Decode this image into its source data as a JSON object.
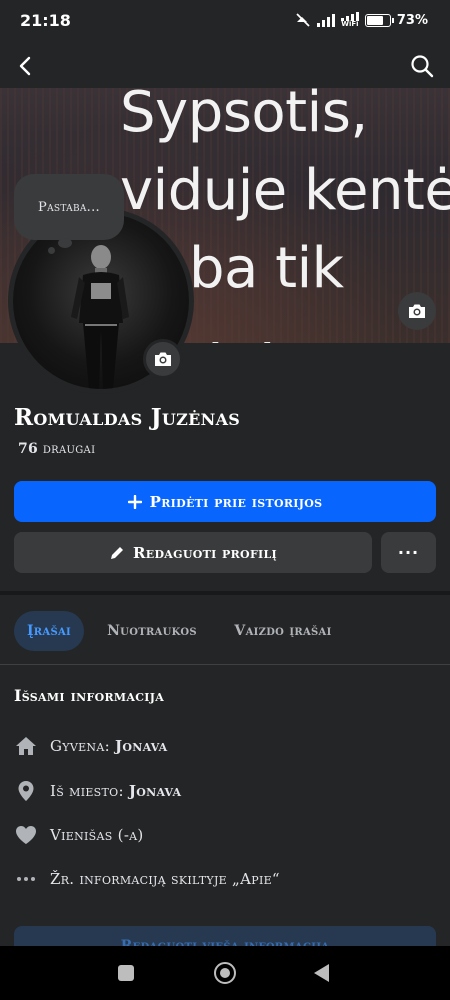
{
  "status_bar": {
    "time": "21:18",
    "wifi_label": "WiFi",
    "battery": "73%",
    "battery_level": 0.73
  },
  "nav": {
    "back_icon": "back-arrow-icon",
    "search_icon": "search-icon"
  },
  "cover": {
    "text": "Sypsotis,\nviduje kentėti,\ngeba tik\n  ·  ·  ·"
  },
  "note": {
    "label": "Pastaba..."
  },
  "profile": {
    "name": "Romualdas Juzėnas",
    "friends_count": "76",
    "friends_label": "draugai"
  },
  "actions": {
    "add_story": "Pridėti prie istorijos",
    "edit_profile": "Redaguoti profilį",
    "more": "···"
  },
  "tabs": [
    {
      "label": "Įrašai",
      "active": true
    },
    {
      "label": "Nuotraukos",
      "active": false
    },
    {
      "label": "Vaizdo įrašai",
      "active": false
    }
  ],
  "details": {
    "title": "Išsami informacija",
    "lives_label": "Gyvena:",
    "lives_value": "Jonava",
    "from_label": "Iš miesto:",
    "from_value": "Jonava",
    "relationship": "Vienišas (-a)",
    "about_link": "Žr. informaciją skiltyje „Apie“"
  },
  "edit_public_info": "Redaguoti viešą informaciją",
  "colors": {
    "accent": "#0866ff",
    "background": "#242526",
    "surface": "#3a3b3c",
    "active_tab_bg": "#263951",
    "active_tab_text": "#4599ff"
  }
}
